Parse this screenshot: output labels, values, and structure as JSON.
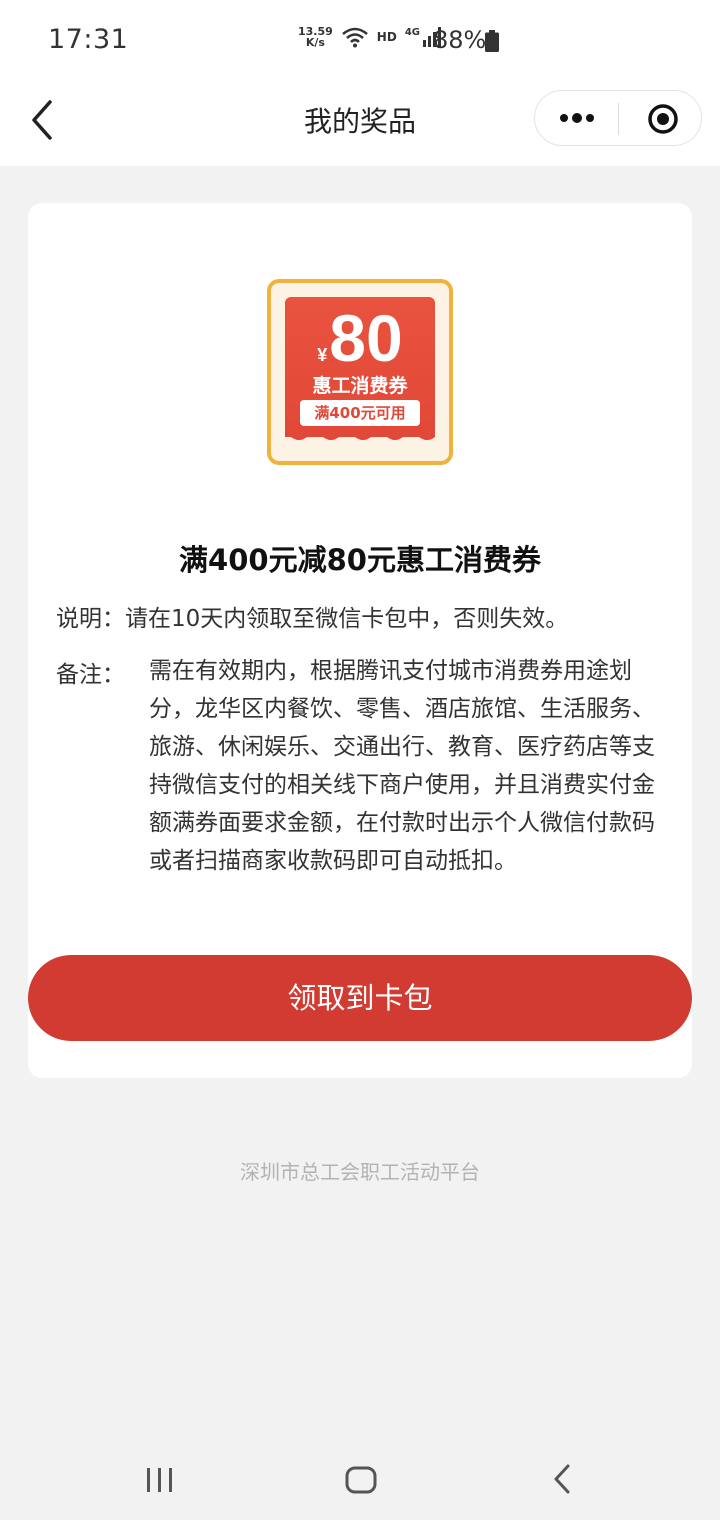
{
  "status_bar": {
    "time": "17:31",
    "net_speed_value": "13.59",
    "net_speed_unit": "K/s",
    "hd": "HD",
    "network": "4G",
    "battery": "88%",
    "icons": [
      "wifi-icon",
      "signal-icon",
      "battery-icon"
    ]
  },
  "nav": {
    "title": "我的奖品",
    "icons": [
      "back-icon",
      "more-icon",
      "close-icon"
    ]
  },
  "coupon": {
    "currency": "¥",
    "amount": "80",
    "name": "惠工消费券",
    "condition": "满400元可用"
  },
  "prize": {
    "title": "满400元减80元惠工消费券",
    "description": "说明：请在10天内领取至微信卡包中，否则失效。",
    "note_label": "备注：",
    "note_text": "需在有效期内，根据腾讯支付城市消费券用途划分，龙华区内餐饮、零售、酒店旅馆、生活服务、旅游、休闲娱乐、交通出行、教育、医疗药店等支持微信支付的相关线下商户使用，并且消费实付金额满券面要求金额，在付款时出示个人微信付款码或者扫描商家收款码即可自动抵扣。"
  },
  "actions": {
    "claim_label": "领取到卡包"
  },
  "footer": {
    "text": "深圳市总工会职工活动平台"
  },
  "colors": {
    "accent": "#d13b31",
    "coupon_red": "#e24837",
    "coupon_border": "#f0b23a",
    "background": "#f2f2f2"
  }
}
